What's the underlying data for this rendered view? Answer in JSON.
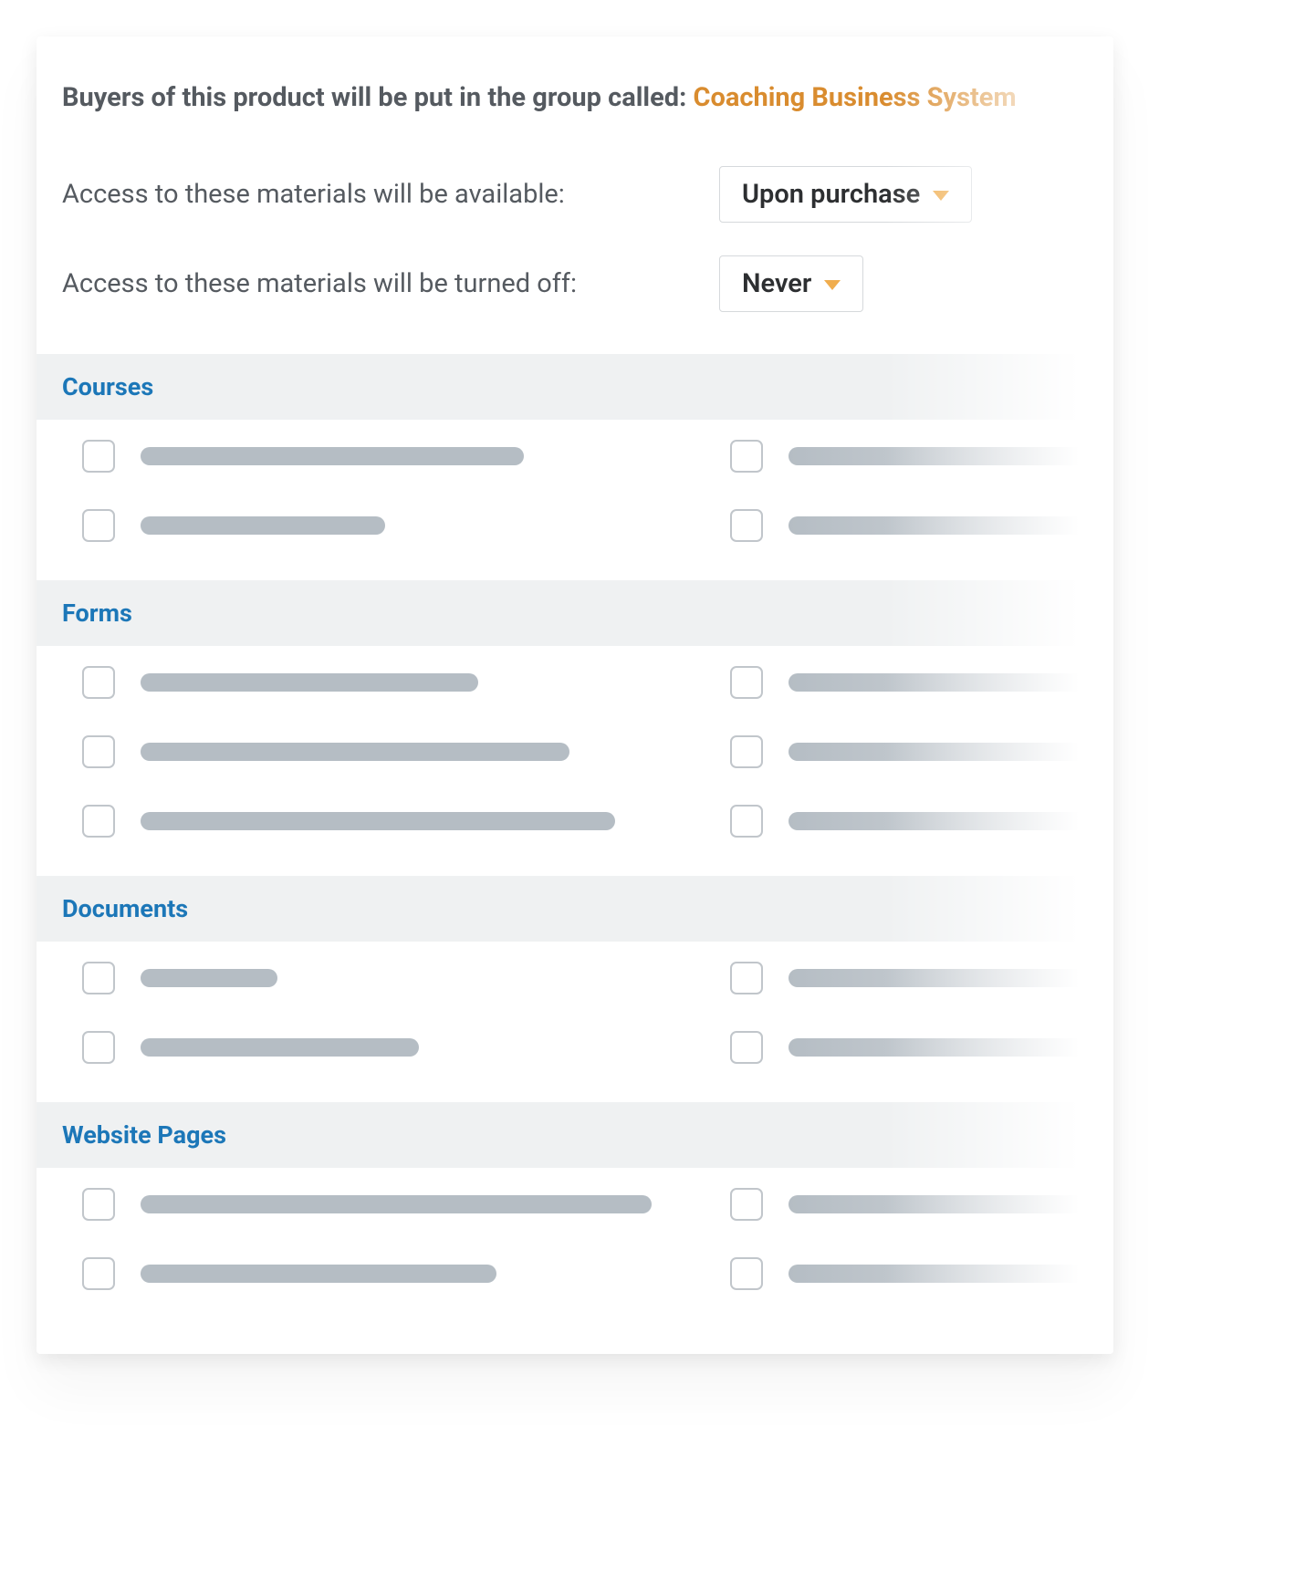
{
  "header": {
    "prefix": "Buyers of this product will be put in the group called: ",
    "group_name": "Coaching Business System"
  },
  "settings": {
    "access_available": {
      "label": "Access to these materials will be available:",
      "value": "Upon purchase"
    },
    "access_off": {
      "label": "Access to these materials will be turned off:",
      "value": "Never"
    }
  },
  "sections": [
    {
      "title": "Courses",
      "rows": [
        {
          "left_width": 420,
          "right_width": 340,
          "right_fade": true
        },
        {
          "left_width": 268,
          "right_width": 340,
          "right_fade": true
        }
      ]
    },
    {
      "title": "Forms",
      "rows": [
        {
          "left_width": 370,
          "right_width": 340,
          "right_fade": true
        },
        {
          "left_width": 470,
          "right_width": 340,
          "right_fade": true
        },
        {
          "left_width": 520,
          "right_width": 340,
          "right_fade": true
        }
      ]
    },
    {
      "title": "Documents",
      "rows": [
        {
          "left_width": 150,
          "right_width": 340,
          "right_fade": true
        },
        {
          "left_width": 305,
          "right_width": 340,
          "right_fade": true
        }
      ]
    },
    {
      "title": "Website Pages",
      "rows": [
        {
          "left_width": 560,
          "right_width": 340,
          "right_fade": true
        },
        {
          "left_width": 390,
          "right_width": 340,
          "right_fade": true
        }
      ]
    }
  ]
}
